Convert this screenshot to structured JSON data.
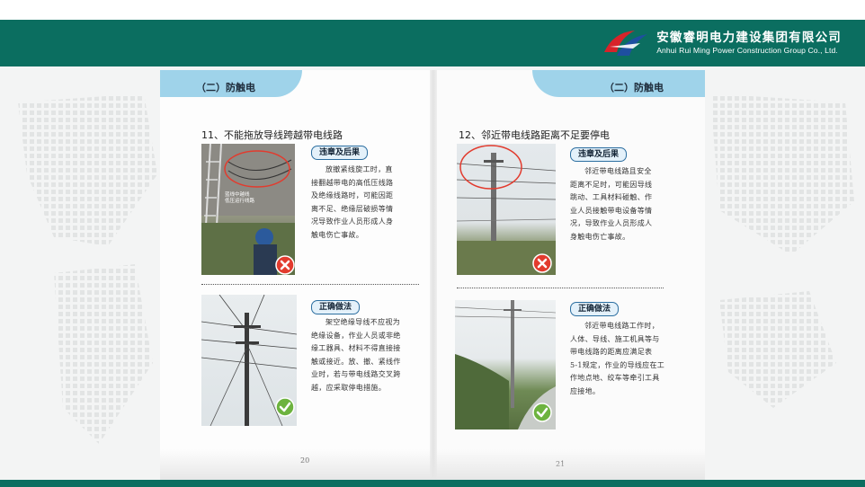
{
  "company": {
    "name_cn": "安徽睿明电力建设集团有限公司",
    "name_en": "Anhui Rui Ming Power Construction Group  Co., Ltd."
  },
  "colors": {
    "header": "#0b6e60",
    "tab": "#9fd3ea",
    "logo_red": "#d8232a",
    "logo_blue": "#1e4fa0"
  },
  "left_page": {
    "tab_label": "（二）防触电",
    "section_title": "11、不能拖放导线跨越带电线路",
    "violation_label": "违章及后果",
    "violation_text": [
      "放撤紧线旋工时，直",
      "接翻越带电的高低压线路",
      "及绝缘线路时，可能因距",
      "离不足、绝缘层破损等情",
      "况导致作业人员形成人身",
      "触电伤亡事故。"
    ],
    "photo_caption": [
      "蓝线中越线",
      "低压运行线路"
    ],
    "correct_label": "正确做法",
    "correct_text": [
      "架空绝缘导线不应视为",
      "绝缘设备，作业人员或非绝",
      "缘工器具、材料不得直接接",
      "触或接近。放、撤、紧线作",
      "业时，若与带电线路交叉跨",
      "越，应采取停电措施。"
    ],
    "page_number": "20"
  },
  "right_page": {
    "tab_label": "（二）防触电",
    "section_title": "12、邻近带电线路距离不足要停电",
    "violation_label": "违章及后果",
    "violation_text": [
      "邻近带电线路且安全",
      "距离不足时，可能因导线",
      "跳动、工具材料碰触、作",
      "业人员接触带电设备等情",
      "况，导致作业人员形成人",
      "身触电伤亡事故。"
    ],
    "correct_label": "正确做法",
    "correct_text": [
      "邻近带电线路工作时，",
      "人体、导线、施工机具等与",
      "带电线路的距离应满足表",
      "5-1规定，作业的导线应在工",
      "作地点地、绞车等牵引工具",
      "应接地。"
    ],
    "page_number": "21"
  },
  "icons": {
    "wrong": "cross-icon",
    "right": "check-icon"
  }
}
